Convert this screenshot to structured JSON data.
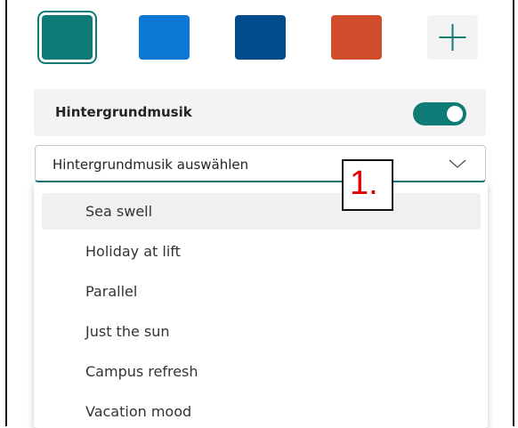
{
  "colors": {
    "accent": "#0f7b76",
    "swatch_teal": "#0f7b76",
    "swatch_blue": "#0a78d4",
    "swatch_navy": "#004b8c",
    "swatch_orange": "#d04e2b",
    "annotation_red": "#e00000"
  },
  "swatches": [
    {
      "name": "teal",
      "color": "#0f7b76",
      "selected": true
    },
    {
      "name": "blue",
      "color": "#0a78d4",
      "selected": false
    },
    {
      "name": "navy",
      "color": "#004b8c",
      "selected": false
    },
    {
      "name": "orange",
      "color": "#d04e2b",
      "selected": false
    }
  ],
  "add_swatch": {
    "icon": "plus-icon"
  },
  "background_music": {
    "label": "Hintergrundmusik",
    "toggle_on": true
  },
  "music_dropdown": {
    "placeholder": "Hintergrundmusik auswählen",
    "icon": "chevron-down-icon"
  },
  "annotation": {
    "text": "1."
  },
  "music_options": [
    {
      "label": "Sea swell",
      "active": true
    },
    {
      "label": "Holiday at lift",
      "active": false
    },
    {
      "label": "Parallel",
      "active": false
    },
    {
      "label": "Just the sun",
      "active": false
    },
    {
      "label": "Campus refresh",
      "active": false
    },
    {
      "label": "Vacation mood",
      "active": false
    }
  ]
}
